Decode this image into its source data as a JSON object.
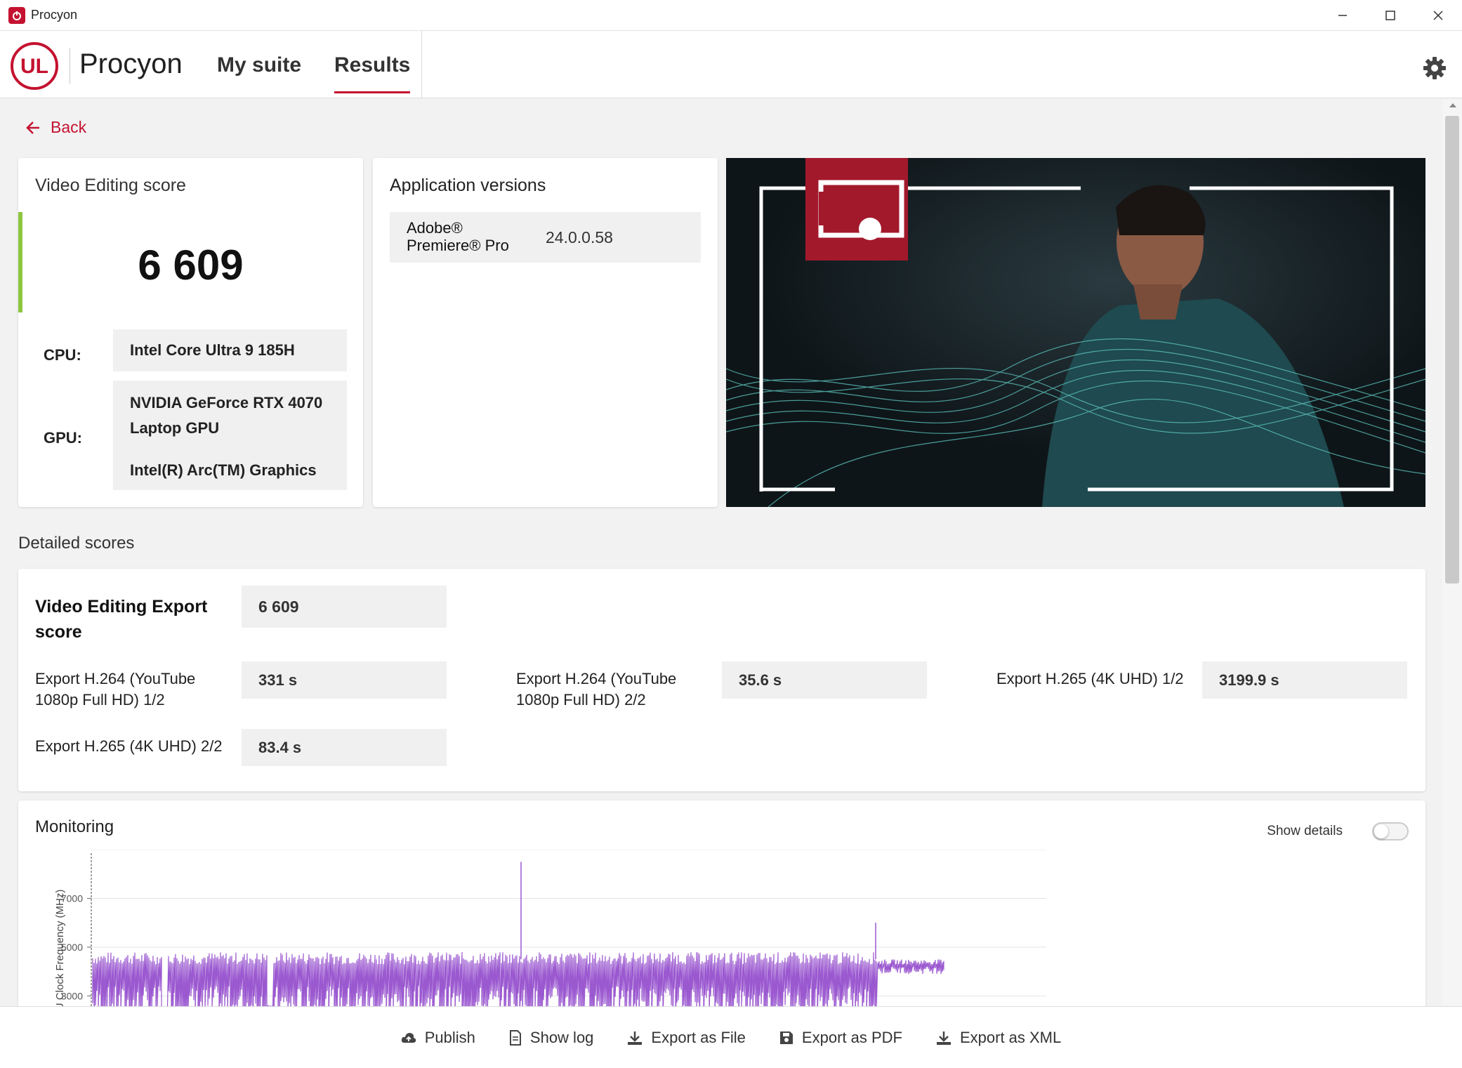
{
  "window": {
    "title": "Procyon"
  },
  "header": {
    "brand": "Procyon",
    "tabs": [
      {
        "label": "My suite"
      },
      {
        "label": "Results"
      }
    ],
    "logo_text": "UL"
  },
  "back": {
    "label": "Back"
  },
  "score_card": {
    "title": "Video Editing score",
    "score": "6 609",
    "cpu_label": "CPU:",
    "cpu_value": "Intel Core Ultra 9 185H",
    "gpu_label": "GPU:",
    "gpu_values": [
      "NVIDIA GeForce RTX 4070",
      "Laptop GPU",
      "Intel(R) Arc(TM) Graphics"
    ]
  },
  "app_versions": {
    "title": "Application versions",
    "items": [
      {
        "name": "Adobe® Premiere® Pro",
        "version": "24.0.0.58"
      }
    ]
  },
  "detailed": {
    "title": "Detailed scores",
    "main_label": "Video Editing Export score",
    "main_value": "6 609",
    "items": [
      {
        "label": "Export H.264 (YouTube 1080p Full HD) 1/2",
        "value": "331 s"
      },
      {
        "label": "Export H.264 (YouTube 1080p Full HD) 2/2",
        "value": "35.6 s"
      },
      {
        "label": "Export H.265 (4K UHD) 1/2",
        "value": "3199.9 s"
      },
      {
        "label": "Export H.265 (4K UHD) 2/2",
        "value": "83.4 s"
      }
    ]
  },
  "monitoring": {
    "title": "Monitoring",
    "show_details_label": "Show details",
    "show_details_on": false
  },
  "chart_data": {
    "type": "line",
    "ylabel": "CPU Clock Frequency (MHz)",
    "yticks": [
      3000,
      5000,
      7000
    ],
    "ylim": [
      1800,
      9000
    ],
    "series": [
      {
        "values": "dense clock trace, mostly 1800-4800 MHz, spikes near 8500 and 6000 MHz"
      }
    ],
    "color": "#9b59d0"
  },
  "bottom_bar": {
    "buttons": [
      {
        "label": "Publish",
        "icon": "cloud-upload-icon"
      },
      {
        "label": "Show log",
        "icon": "document-icon"
      },
      {
        "label": "Export as File",
        "icon": "download-icon"
      },
      {
        "label": "Export as PDF",
        "icon": "save-icon"
      },
      {
        "label": "Export as XML",
        "icon": "download-icon"
      }
    ]
  },
  "colors": {
    "accent": "#c41230",
    "score_bar": "#8dc63f",
    "chart_line": "#9b59d0"
  }
}
